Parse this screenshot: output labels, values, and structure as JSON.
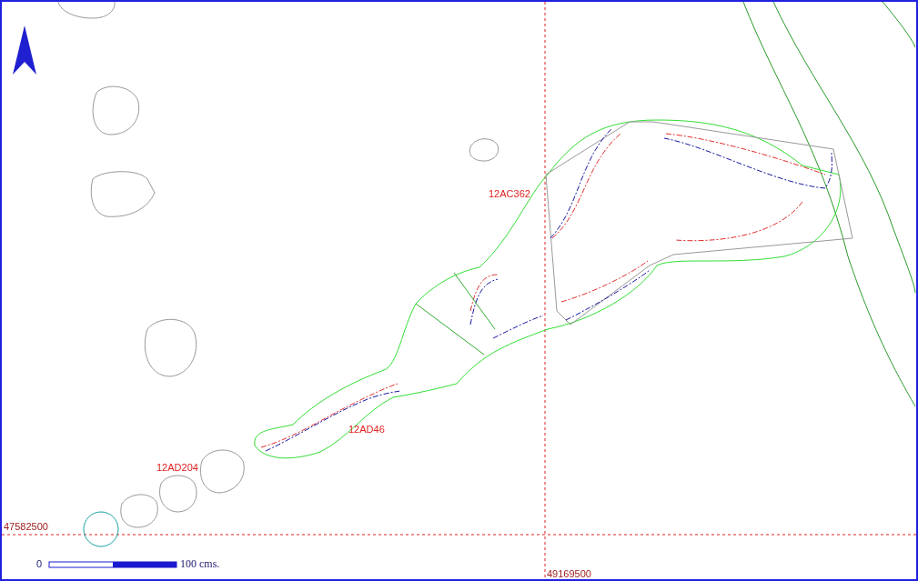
{
  "plan": {
    "feature_labels": [
      {
        "text": "12AC362"
      },
      {
        "text": "12AD46"
      },
      {
        "text": "12AD204"
      }
    ],
    "grid_labels": {
      "northing": "47582500",
      "easting": "49169500"
    },
    "scale_bar": {
      "start": "0",
      "end": "100 cms."
    }
  }
}
